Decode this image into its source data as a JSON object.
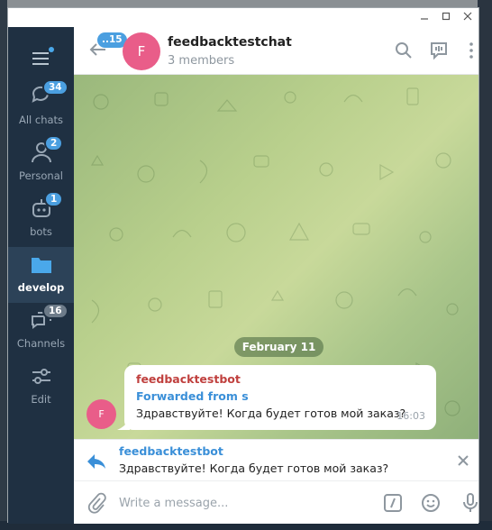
{
  "sidebar": {
    "folders": [
      {
        "label": "All chats",
        "badge": "34",
        "icon": "chats-icon"
      },
      {
        "label": "Personal",
        "badge": "2",
        "icon": "person-icon"
      },
      {
        "label": "bots",
        "badge": "1",
        "icon": "bot-icon"
      },
      {
        "label": "develop",
        "badge": "",
        "icon": "folder-icon",
        "active": true
      },
      {
        "label": "Channels",
        "badge": "16",
        "icon": "channels-icon"
      },
      {
        "label": "Edit",
        "badge": "",
        "icon": "edit-icon"
      }
    ]
  },
  "header": {
    "back_badge": "..15",
    "avatar_letter": "F",
    "title": "feedbacktestchat",
    "subtitle": "3 members"
  },
  "chat": {
    "date": "February 11",
    "message": {
      "avatar_letter": "F",
      "sender": "feedbacktestbot",
      "forwarded": "Forwarded from s",
      "text": "Здравствуйте! Когда будет готов мой заказ?",
      "time": "16:03"
    }
  },
  "reply": {
    "name": "feedbacktestbot",
    "text": "Здравствуйте! Когда будет готов мой заказ?"
  },
  "composer": {
    "placeholder": "Write a message..."
  },
  "colors": {
    "sidebar_bg": "#1f3042",
    "accent": "#4b9fe0",
    "avatar": "#e95d89",
    "sender": "#c0403e"
  }
}
